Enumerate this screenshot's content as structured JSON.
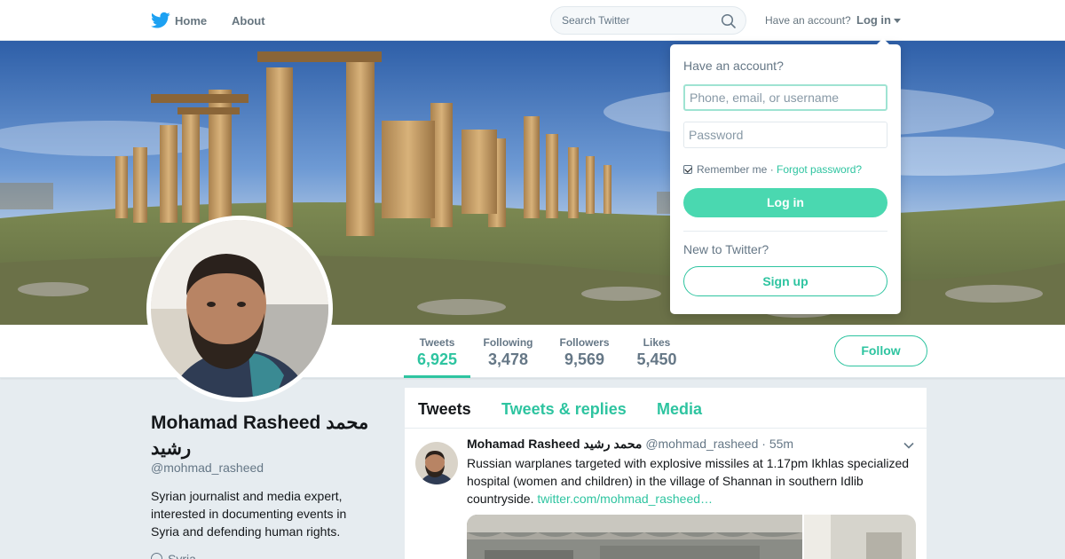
{
  "nav": {
    "home_label": "Home",
    "about_label": "About",
    "search_placeholder": "Search Twitter",
    "have_account": "Have an account?",
    "login_label": "Log in",
    "logo_icon": "twitter-bird-icon",
    "brand_color": "#1da1f2"
  },
  "profile": {
    "name": "Mohamad Rasheed محمد رشيد",
    "handle": "@mohmad_rasheed",
    "bio": "Syrian journalist and media expert, interested in documenting events in Syria and defending human rights.",
    "location": "Syria",
    "accent_color": "#2ec4a0"
  },
  "stats": [
    {
      "label": "Tweets",
      "value": "6,925"
    },
    {
      "label": "Following",
      "value": "3,478"
    },
    {
      "label": "Followers",
      "value": "9,569"
    },
    {
      "label": "Likes",
      "value": "5,450"
    }
  ],
  "follow_label": "Follow",
  "timeline": {
    "tabs": [
      "Tweets",
      "Tweets & replies",
      "Media"
    ],
    "tweet": {
      "name": "Mohamad Rasheed محمد رشيد",
      "handle": "@mohmad_rasheed",
      "time": "55m",
      "text": "Russian warplanes targeted with explosive missiles at 1.17pm Ikhlas specialized hospital (women and children) in the village of Shannan in southern Idlib countryside.",
      "link": "twitter.com/mohmad_rasheed…"
    }
  },
  "login_dropdown": {
    "title": "Have an account?",
    "username_placeholder": "Phone, email, or username",
    "password_placeholder": "Password",
    "remember_me": "Remember me",
    "separator": " · ",
    "forgot_password": "Forgot password?",
    "login_button": "Log in",
    "new_to_twitter": "New to Twitter?",
    "signup_button": "Sign up"
  }
}
